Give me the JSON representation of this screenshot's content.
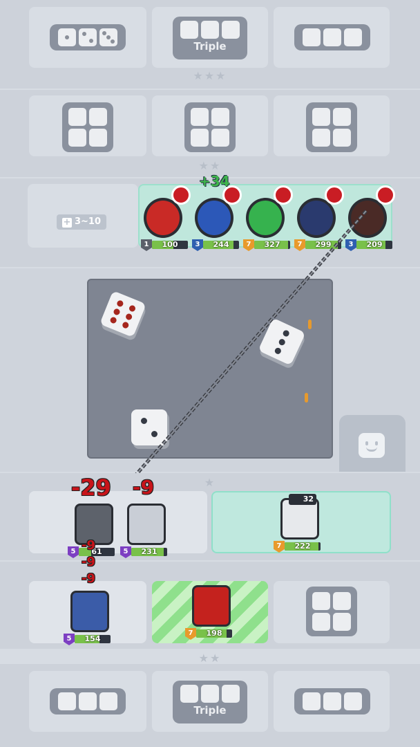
{
  "top_tier": {
    "triple_label": "Triple"
  },
  "enemy_row": {
    "range_label": "3~10",
    "heal_popup": "+34"
  },
  "enemies": [
    {
      "name": "red-shield-enemy",
      "level": "1",
      "hp": "100",
      "hp_fraction": 0.6,
      "level_color": "#5a5f6a"
    },
    {
      "name": "blue-knight-enemy",
      "level": "3",
      "hp": "244",
      "hp_fraction": 0.85,
      "level_color": "#2f5fb0"
    },
    {
      "name": "green-orb-enemy",
      "level": "7",
      "hp": "327",
      "hp_fraction": 0.95,
      "level_color": "#e89a2c"
    },
    {
      "name": "dark-armor-enemy",
      "level": "7",
      "hp": "299",
      "hp_fraction": 0.9,
      "level_color": "#e89a2c"
    },
    {
      "name": "dark-claw-enemy",
      "level": "3",
      "hp": "209",
      "hp_fraction": 0.8,
      "level_color": "#2f5fb0"
    }
  ],
  "player_units": [
    {
      "level": "5",
      "hp": "61",
      "hp_fraction": 0.35,
      "level_color": "#7d3fc2"
    },
    {
      "level": "5",
      "hp": "231",
      "hp_fraction": 0.9,
      "level_color": "#7d3fc2"
    },
    {
      "level": "7",
      "hp": "222",
      "hp_fraction": 0.95,
      "level_color": "#e89a2c"
    },
    {
      "level": "5",
      "hp": "154",
      "hp_fraction": 0.7,
      "level_color": "#7d3fc2"
    },
    {
      "level": "7",
      "hp": "198",
      "hp_fraction": 0.85,
      "level_color": "#e89a2c"
    }
  ],
  "damage_popups": [
    "-29",
    "-9",
    "-9",
    "-9",
    "-9"
  ],
  "battery_counter": "32",
  "colors": {
    "frame": "#c8ced7",
    "slot": "#d9dee5",
    "arena": "#7f8592",
    "hp_green": "#79c14a",
    "damage_red": "#c8141a",
    "heal_green": "#3fb54c"
  }
}
